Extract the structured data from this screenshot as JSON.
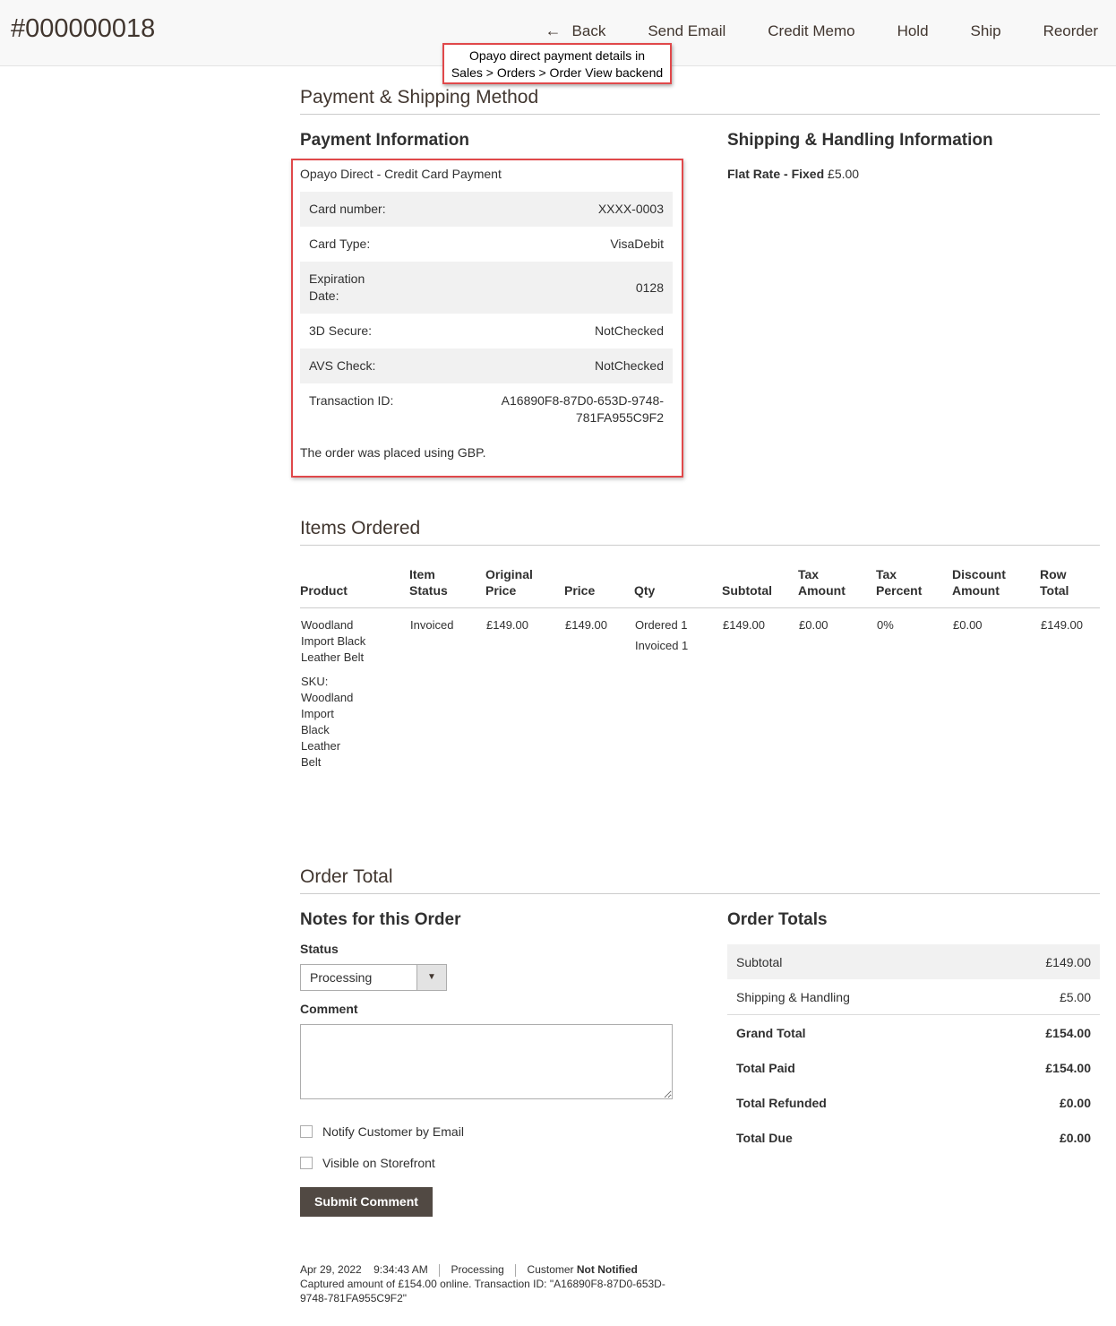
{
  "header": {
    "order_number": "#000000018",
    "back": "Back",
    "send_email": "Send Email",
    "credit_memo": "Credit Memo",
    "hold": "Hold",
    "ship": "Ship",
    "reorder": "Reorder"
  },
  "callout": {
    "line1": "Opayo direct payment details in",
    "line2": "Sales > Orders > Order View backend"
  },
  "payment_shipping": {
    "title": "Payment & Shipping Method",
    "payment_title": "Payment Information",
    "method": "Opayo Direct - Credit Card Payment",
    "rows": [
      {
        "label": "Card number:",
        "value": "XXXX-0003"
      },
      {
        "label": "Card Type:",
        "value": "VisaDebit"
      },
      {
        "label": "Expiration Date:",
        "value": "0128"
      },
      {
        "label": "3D Secure:",
        "value": "NotChecked"
      },
      {
        "label": "AVS Check:",
        "value": "NotChecked"
      },
      {
        "label": "Transaction ID:",
        "value": "A16890F8-87D0-653D-9748-781FA955C9F2"
      }
    ],
    "currency_note": "The order was placed using GBP.",
    "shipping_title": "Shipping & Handling Information",
    "shipping_method": "Flat Rate - Fixed",
    "shipping_price": "£5.00"
  },
  "items": {
    "title": "Items Ordered",
    "headers": [
      "Product",
      "Item Status",
      "Original Price",
      "Price",
      "Qty",
      "Subtotal",
      "Tax Amount",
      "Tax Percent",
      "Discount Amount",
      "Row Total"
    ],
    "row": {
      "product": "Woodland Import Black Leather Belt",
      "sku_label": "SKU:",
      "sku": "Woodland Import Black Leather Belt",
      "status": "Invoiced",
      "original_price": "£149.00",
      "price": "£149.00",
      "qty_ordered": "Ordered 1",
      "qty_invoiced": "Invoiced 1",
      "subtotal": "£149.00",
      "tax_amount": "£0.00",
      "tax_percent": "0%",
      "discount": "£0.00",
      "row_total": "£149.00"
    }
  },
  "order_total": {
    "title": "Order Total",
    "notes_title": "Notes for this Order",
    "status_label": "Status",
    "status_value": "Processing",
    "comment_label": "Comment",
    "notify_label": "Notify Customer by Email",
    "visible_label": "Visible on Storefront",
    "submit": "Submit Comment",
    "history": {
      "date": "Apr 29, 2022",
      "time": "9:34:43 AM",
      "status": "Processing",
      "customer": "Customer",
      "notified": "Not Notified",
      "message": "Captured amount of £154.00 online. Transaction ID: \"A16890F8-87D0-653D-9748-781FA955C9F2\""
    },
    "totals_title": "Order Totals",
    "totals": [
      {
        "label": "Subtotal",
        "value": "£149.00"
      },
      {
        "label": "Shipping & Handling",
        "value": "£5.00"
      },
      {
        "label": "Grand Total",
        "value": "£154.00"
      },
      {
        "label": "Total Paid",
        "value": "£154.00"
      },
      {
        "label": "Total Refunded",
        "value": "£0.00"
      },
      {
        "label": "Total Due",
        "value": "£0.00"
      }
    ]
  }
}
